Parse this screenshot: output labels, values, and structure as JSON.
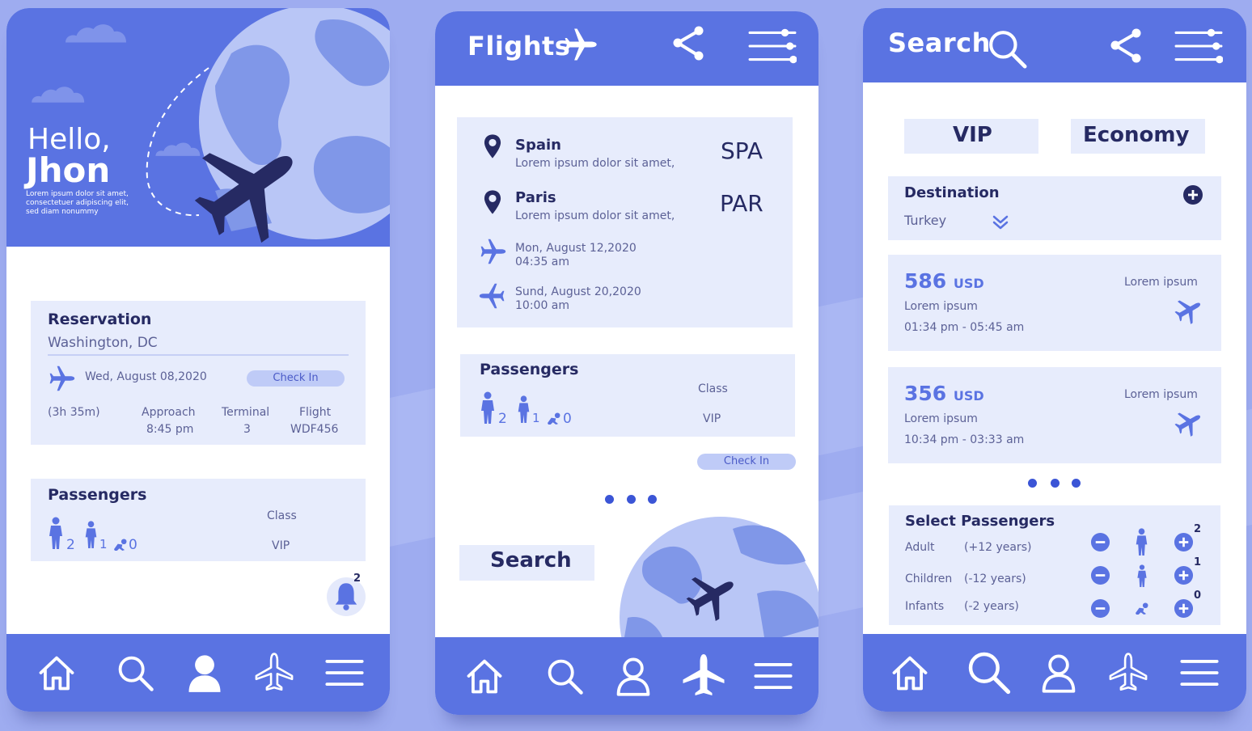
{
  "colors": {
    "background": "#9eacf0",
    "primary": "#5a73e2",
    "card": "#e7ecfc",
    "dark": "#262a63"
  },
  "screen1": {
    "greeting_line1": "Hello,",
    "greeting_line2": "Jhon",
    "greeting_desc1": "Lorem ipsum dolor sit amet,",
    "greeting_desc2": "consectetuer adipiscing elit,",
    "greeting_desc3": "sed diam nonummy",
    "reservation": {
      "title": "Reservation",
      "location": "Washington, DC",
      "date": "Wed, August  08,2020",
      "checkin": "Check In",
      "duration": "(3h 35m)",
      "approach_label": "Approach",
      "approach_value": "8:45 pm",
      "terminal_label": "Terminal",
      "terminal_value": "3",
      "flight_label": "Flight",
      "flight_value": "WDF456"
    },
    "passengers": {
      "title": "Passengers",
      "adults": "2",
      "children": "1",
      "infants": "0",
      "class_label": "Class",
      "class_value": "VIP"
    },
    "notification_count": "2",
    "nav": [
      "home-icon",
      "search-icon",
      "user-icon",
      "plane-icon",
      "menu-icon"
    ]
  },
  "screen2": {
    "title": "Flights",
    "origin": {
      "city": "Spain",
      "desc": "Lorem ipsum dolor sit amet,",
      "code": "SPA"
    },
    "destination": {
      "city": "Paris",
      "desc": "Lorem ipsum dolor sit amet,",
      "code": "PAR"
    },
    "departure": {
      "date": "Mon, August 12,2020",
      "time": "04:35 am"
    },
    "return": {
      "date": "Sund, August 20,2020",
      "time": "10:00 am"
    },
    "passengers": {
      "title": "Passengers",
      "adults": "2",
      "children": "1",
      "infants": "0",
      "class_label": "Class",
      "class_value": "VIP"
    },
    "checkin": "Check In",
    "search_label": "Search",
    "nav": [
      "home-icon",
      "search-icon",
      "user-icon",
      "plane-icon",
      "menu-icon"
    ]
  },
  "screen3": {
    "title": "Search",
    "tabs": [
      "VIP",
      "Economy"
    ],
    "destination": {
      "label": "Destination",
      "value": "Turkey"
    },
    "results": [
      {
        "price": "586",
        "currency": "USD",
        "name": "Lorem ipsum",
        "time": "01:34 pm - 05:45 am",
        "tag": "Lorem ipsum"
      },
      {
        "price": "356",
        "currency": "USD",
        "name": "Lorem ipsum",
        "time": "10:34 pm - 03:33 am",
        "tag": "Lorem ipsum"
      }
    ],
    "select_passengers": {
      "title": "Select Passengers",
      "rows": [
        {
          "label": "Adult",
          "range": "(+12 years)",
          "count": "2"
        },
        {
          "label": "Children",
          "range": "(-12 years)",
          "count": "1"
        },
        {
          "label": "Infants",
          "range": "(-2 years)",
          "count": "0"
        }
      ]
    },
    "nav": [
      "home-icon",
      "search-icon",
      "user-icon",
      "plane-icon",
      "menu-icon"
    ]
  }
}
